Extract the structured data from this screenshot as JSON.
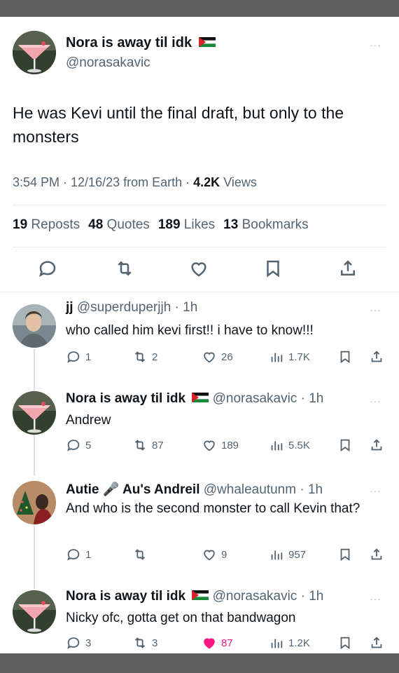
{
  "main_tweet": {
    "author_name": "Nora is away til idk",
    "handle": "@norasakavic",
    "text": "He was Kevi until the final draft, but only to the monsters",
    "time": "3:54 PM · 12/16/23 from Earth ·",
    "views_count": "4.2K",
    "views_label": "Views",
    "stats": {
      "reposts_count": "19",
      "reposts_label": "Reposts",
      "quotes_count": "48",
      "quotes_label": "Quotes",
      "likes_count": "189",
      "likes_label": "Likes",
      "bookmarks_count": "13",
      "bookmarks_label": "Bookmarks"
    },
    "more": "···"
  },
  "replies": [
    {
      "name": "jj",
      "handle_time": "@superduperjjh · 1h",
      "text": "who called him kevi first!! i have to know!!!",
      "replies": "1",
      "reposts": "2",
      "likes": "26",
      "views": "1.7K",
      "liked": false,
      "more": "···"
    },
    {
      "name": "Nora is away til idk",
      "handle_time": "@norasakavic · 1h",
      "text": "Andrew",
      "replies": "5",
      "reposts": "87",
      "likes": "189",
      "views": "5.5K",
      "liked": false,
      "more": "···"
    },
    {
      "name": "Autie",
      "name_emoji": "🎤",
      "name_rest": "Au's Andreil",
      "handle_time": "@whaleautunm · 1h",
      "text": "And who is the second monster to call Kevin that?",
      "replies": "1",
      "reposts": "",
      "likes": "9",
      "views": "957",
      "liked": false,
      "more": "···"
    },
    {
      "name": "Nora is away til idk",
      "handle_time": "@norasakavic · 1h",
      "text": "Nicky ofc, gotta get on that bandwagon",
      "replies": "3",
      "reposts": "3",
      "likes": "87",
      "views": "1.2K",
      "liked": true,
      "more": "···"
    }
  ],
  "colors": {
    "text": "#0f1419",
    "secondary": "#536471",
    "like_pink": "#f91880",
    "divider": "#e6ecf0"
  },
  "icons": [
    "reply-icon",
    "repost-icon",
    "like-icon",
    "bookmark-icon",
    "share-icon",
    "views-icon",
    "flag-icon",
    "more-icon"
  ]
}
